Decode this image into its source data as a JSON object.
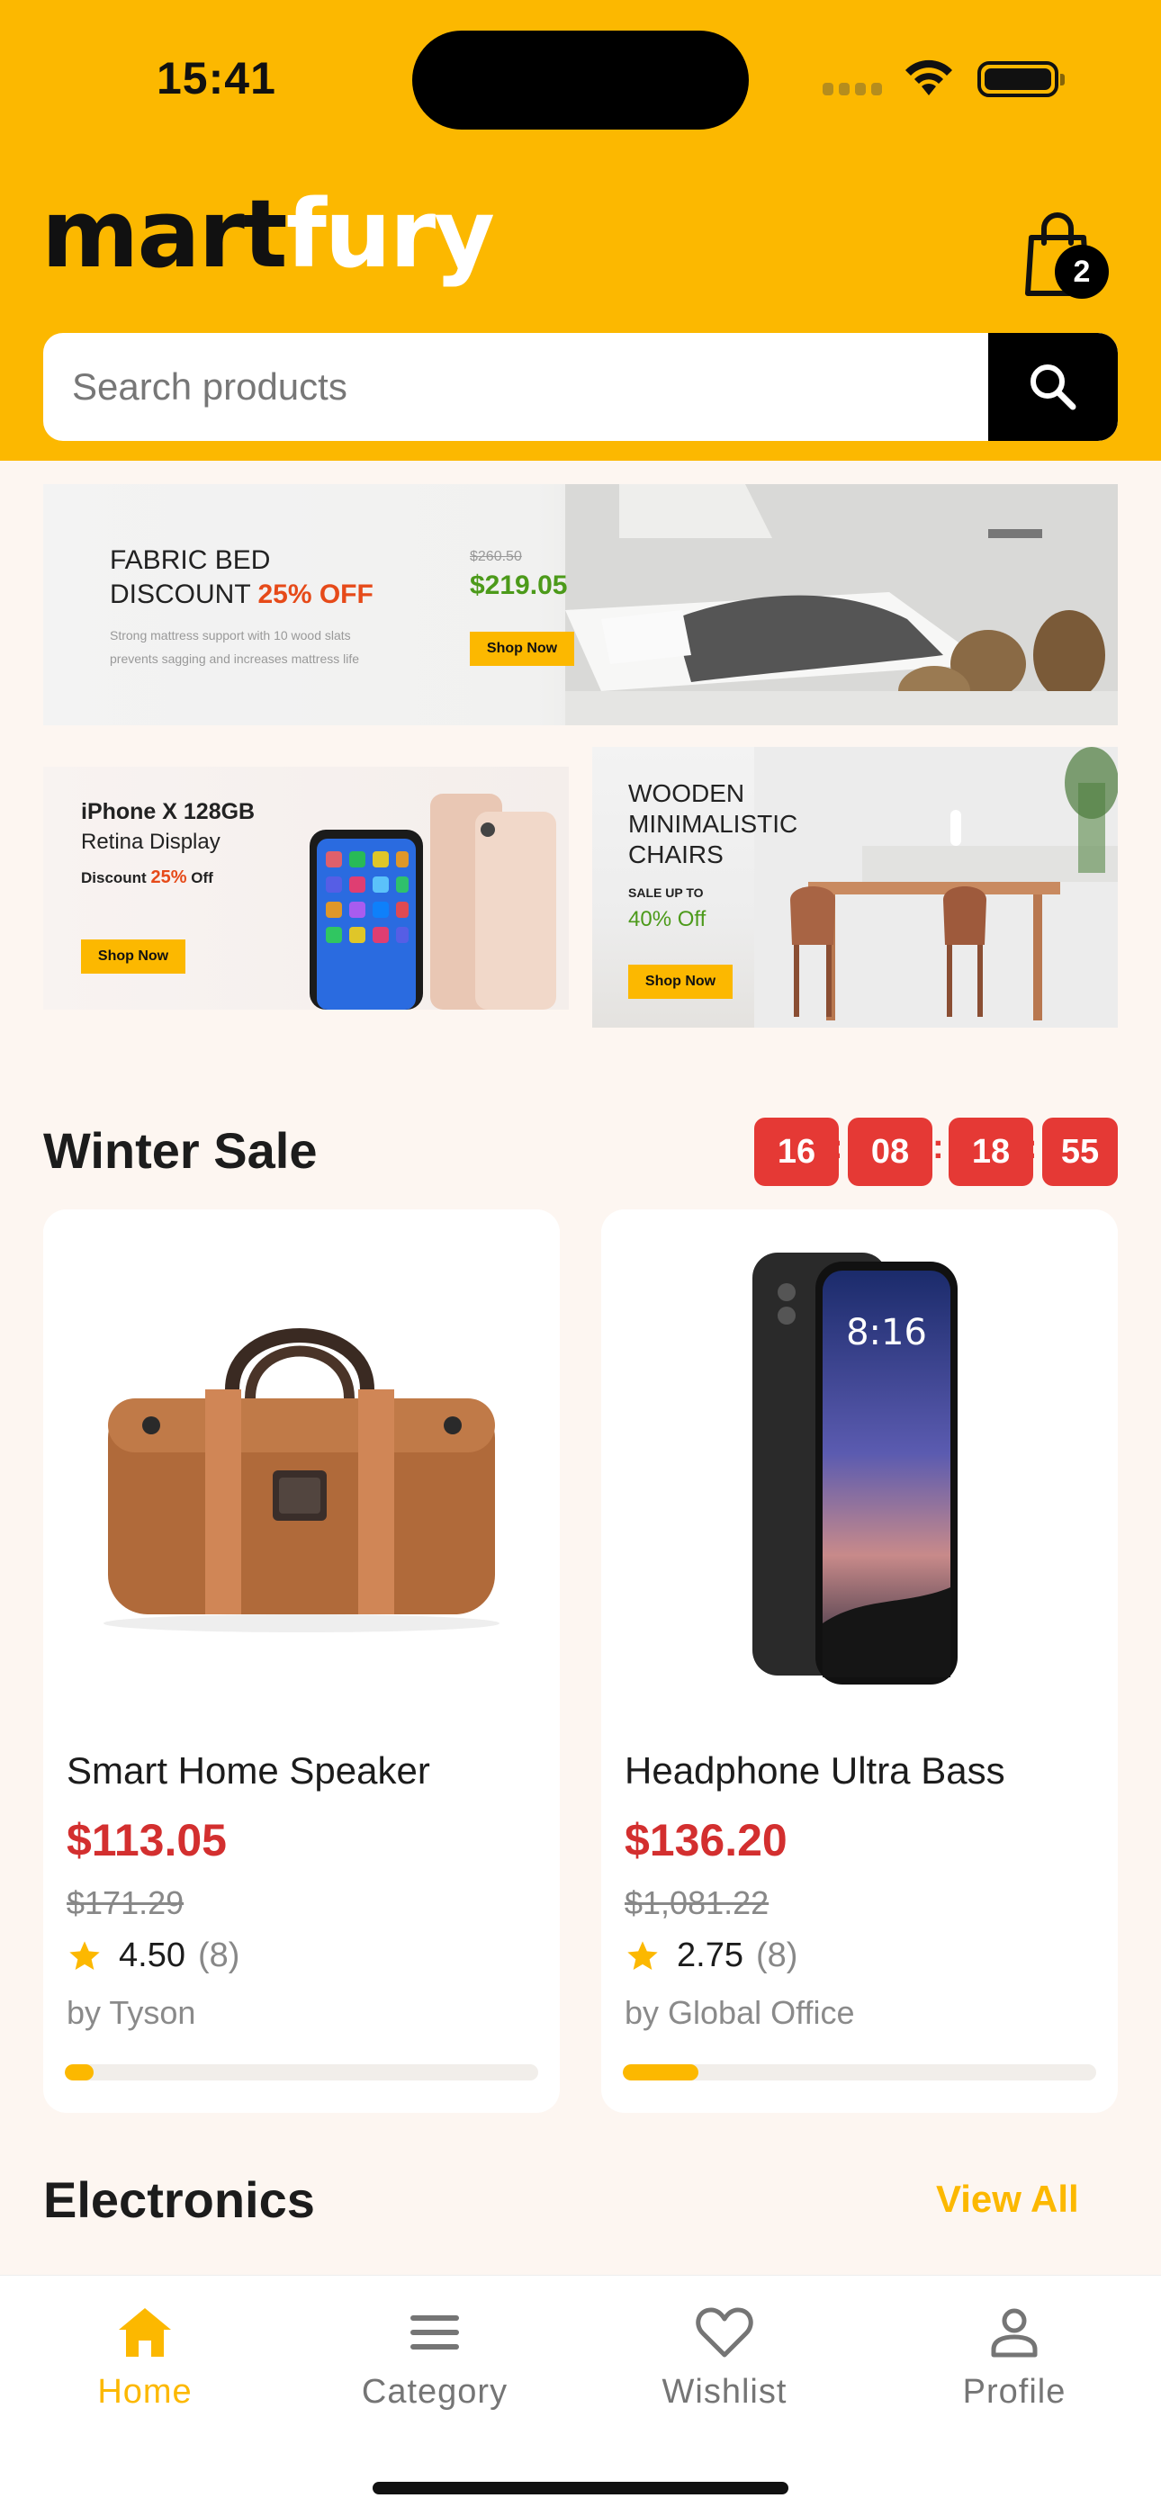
{
  "status_bar": {
    "time": "15:41"
  },
  "header": {
    "logo_part1": "mart",
    "logo_part2": "fury",
    "cart_count": "2",
    "search_placeholder": "Search products"
  },
  "banners": {
    "bed": {
      "title_line1": "FABRIC BED",
      "title_line2": "DISCOUNT",
      "discount": "25% OFF",
      "desc_line1": "Strong mattress support with 10 wood slats",
      "desc_line2": "prevents sagging and increases mattress life",
      "old_price": "$260.50",
      "price": "$219.05",
      "button": "Shop Now"
    },
    "phone": {
      "title": "iPhone X 128GB",
      "subtitle": "Retina Display",
      "discount_label": "Discount",
      "discount_value": "25%",
      "discount_suffix": "Off",
      "button": "Shop Now"
    },
    "chairs": {
      "line1": "WOODEN",
      "line2": "MINIMALISTIC",
      "line3": "CHAIRS",
      "sale_label": "SALE UP TO",
      "sale_value": "40% Off",
      "button": "Shop Now"
    }
  },
  "winter_sale": {
    "title": "Winter Sale",
    "timer": [
      "16",
      "08",
      "18",
      "55"
    ],
    "products": [
      {
        "name": "Smart Home Speaker",
        "price": "$113.05",
        "old_price": "$171.29",
        "rating": "4.50",
        "reviews": "(8)",
        "vendor": "by Tyson",
        "sold_progress": 0.06
      },
      {
        "name": "Headphone Ultra Bass",
        "price": "$136.20",
        "old_price": "$1,081.22",
        "rating": "2.75",
        "reviews": "(8)",
        "vendor": "by Global Office",
        "sold_progress": 0.16
      }
    ]
  },
  "electronics": {
    "title": "Electronics",
    "view_all": "View All"
  },
  "bottom_nav": [
    {
      "label": "Home",
      "icon": "home-icon",
      "active": true
    },
    {
      "label": "Category",
      "icon": "menu-icon",
      "active": false
    },
    {
      "label": "Wishlist",
      "icon": "heart-icon",
      "active": false
    },
    {
      "label": "Profile",
      "icon": "user-icon",
      "active": false
    }
  ],
  "colors": {
    "brand": "#fcb800",
    "sale": "#e53935",
    "price": "#d32f2f"
  }
}
